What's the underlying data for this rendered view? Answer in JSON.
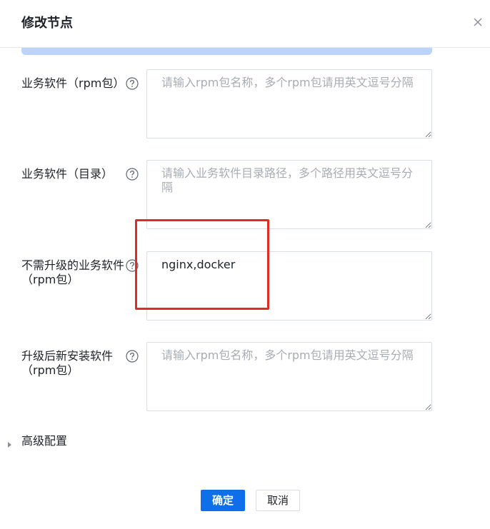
{
  "dialog": {
    "title": "修改节点",
    "close_icon": "close-icon"
  },
  "form": {
    "fields": [
      {
        "label": "业务软件（rpm包）",
        "value": "",
        "placeholder": "请输入rpm包名称，多个rpm包请用英文逗号分隔"
      },
      {
        "label": "业务软件（目录）",
        "value": "",
        "placeholder": "请输入业务软件目录路径，多个路径用英文逗号分隔"
      },
      {
        "label": "不需升级的业务软件（rpm包）",
        "value": "nginx,docker",
        "placeholder": ""
      },
      {
        "label": "升级后新安装软件（rpm包）",
        "value": "",
        "placeholder": "请输入rpm包名称，多个rpm包请用英文逗号分隔"
      }
    ],
    "help_icon": "question-circle-icon"
  },
  "advanced": {
    "label": "高级配置",
    "expanded": false
  },
  "footer": {
    "confirm_label": "确定",
    "cancel_label": "取消"
  },
  "colors": {
    "primary": "#0f6fe8",
    "highlight": "#e22a26",
    "info_strip": "#bcd4fb"
  }
}
